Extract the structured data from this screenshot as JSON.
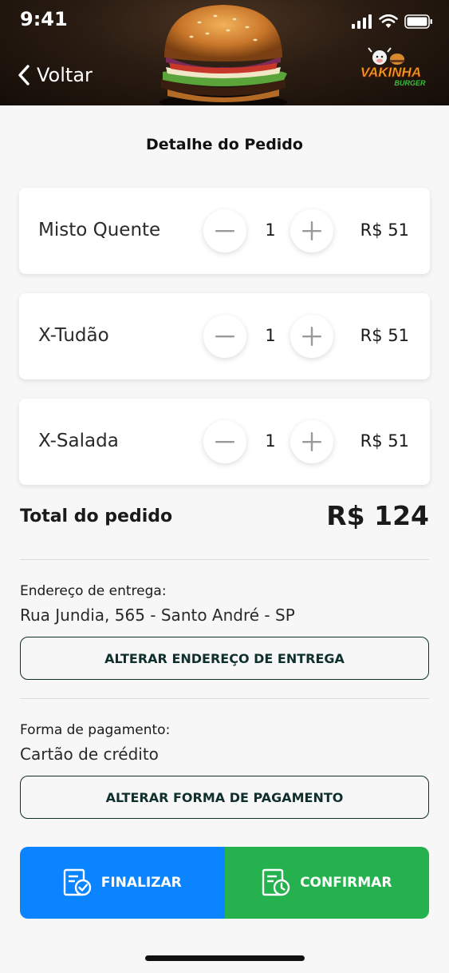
{
  "status_bar": {
    "time": "9:41"
  },
  "header": {
    "back_label": "Voltar",
    "logo_text_1": "VAKINHA",
    "logo_text_2": "BURGER"
  },
  "page": {
    "title": "Detalhe do Pedido"
  },
  "items": [
    {
      "name": "Misto Quente",
      "quantity": "1",
      "price": "R$ 51"
    },
    {
      "name": "X-Tudão",
      "quantity": "1",
      "price": "R$ 51"
    },
    {
      "name": "X-Salada",
      "quantity": "1",
      "price": "R$ 51"
    }
  ],
  "total": {
    "label": "Total do pedido",
    "value": "R$ 124"
  },
  "address": {
    "label": "Endereço de entrega:",
    "value": "Rua Jundia, 565 - Santo André - SP",
    "button": "ALTERAR ENDEREÇO DE ENTREGA"
  },
  "payment": {
    "label": "Forma de pagamento:",
    "value": "Cartão de crédito",
    "button": "ALTERAR FORMA DE PAGAMENTO"
  },
  "actions": {
    "finalizar": "FINALIZAR",
    "confirmar": "CONFIRMAR"
  },
  "colors": {
    "finalizar": "#0a84ff",
    "confirmar": "#25b14d",
    "outline": "#0f2f2c"
  }
}
